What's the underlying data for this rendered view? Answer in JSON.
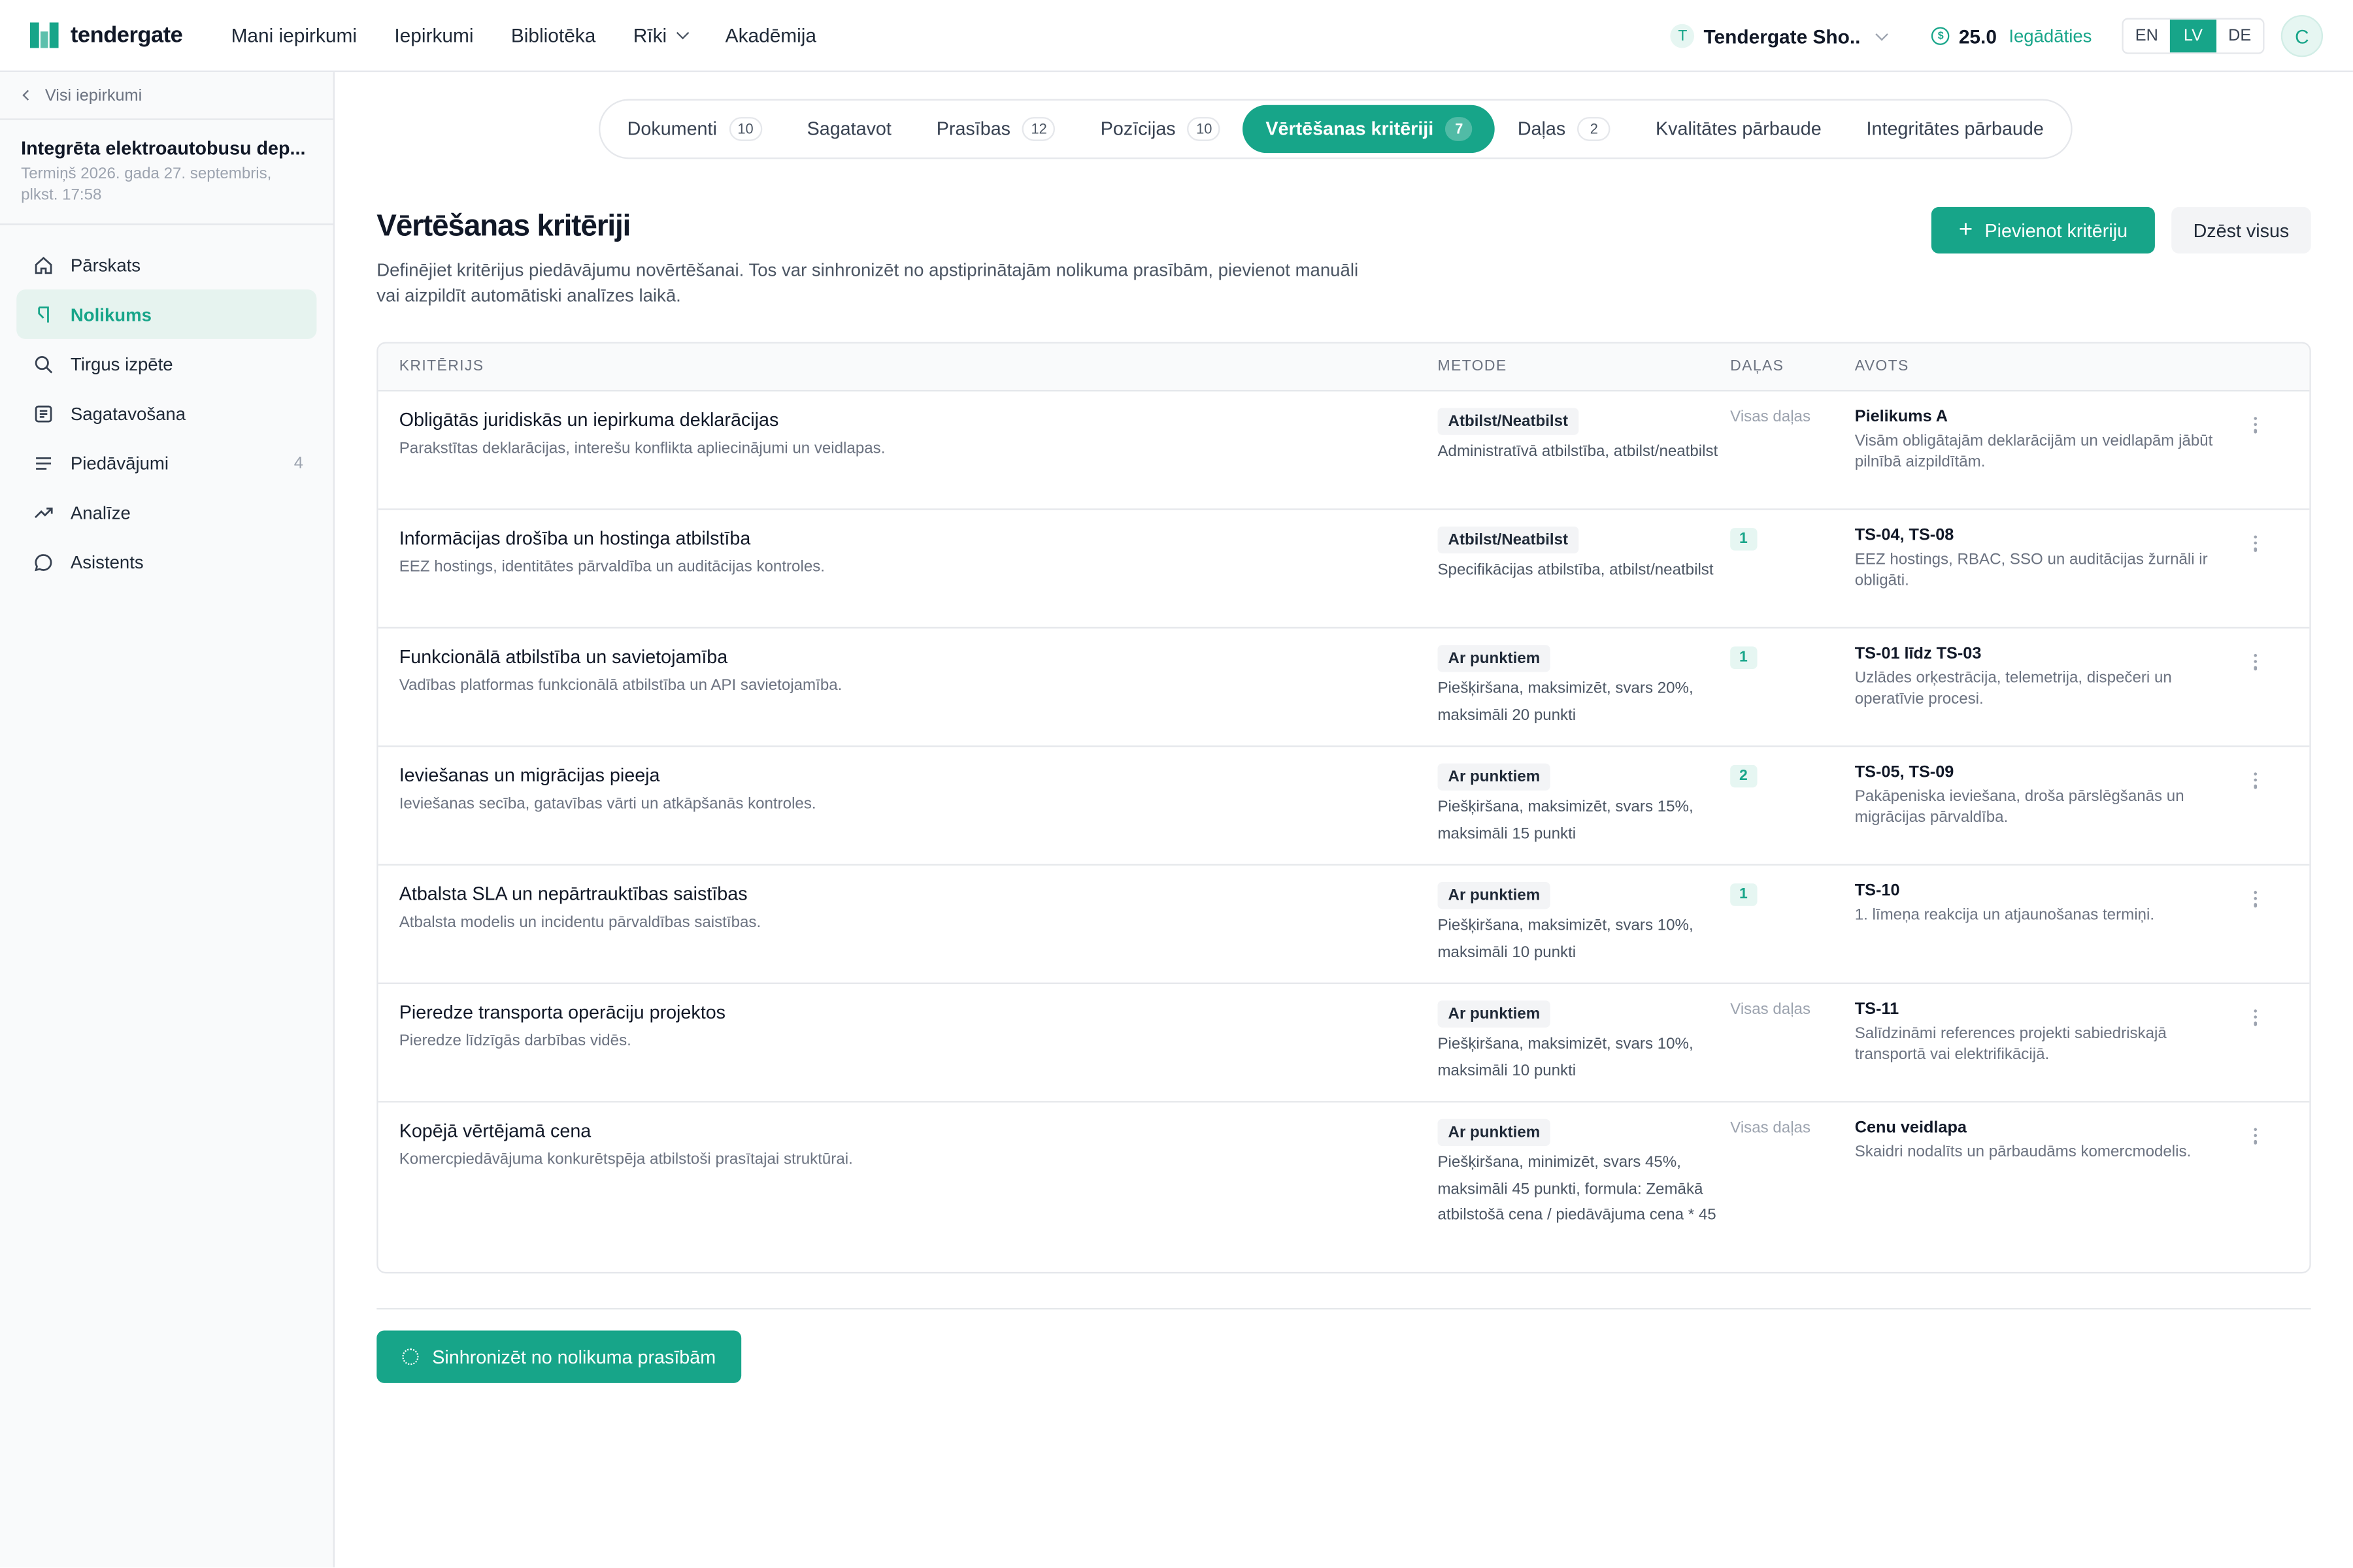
{
  "brand": {
    "name": "tendergate"
  },
  "topnav": [
    {
      "label": "Mani iepirkumi"
    },
    {
      "label": "Iepirkumi"
    },
    {
      "label": "Bibliotēka"
    },
    {
      "label": "Rīki"
    },
    {
      "label": "Akadēmija"
    }
  ],
  "workspace": {
    "initial": "T",
    "name": "Tendergate Sho..."
  },
  "credits": {
    "value": "25.0",
    "link": "Iegādāties"
  },
  "languages": [
    {
      "code": "EN"
    },
    {
      "code": "LV"
    },
    {
      "code": "DE"
    }
  ],
  "user": {
    "initial": "C"
  },
  "sidebar": {
    "back": "Visi iepirkumi",
    "project_title": "Integrēta elektroautobusu dep...",
    "project_deadline": "Termiņš 2026. gada 27. septembris, plkst. 17:58",
    "items": [
      {
        "label": "Pārskats",
        "icon": "home-icon"
      },
      {
        "label": "Nolikums",
        "icon": "document-icon"
      },
      {
        "label": "Tirgus izpēte",
        "icon": "search-icon"
      },
      {
        "label": "Sagatavošana",
        "icon": "edit-icon"
      },
      {
        "label": "Piedāvājumi",
        "icon": "list-icon",
        "count": "4"
      },
      {
        "label": "Analīze",
        "icon": "trend-icon"
      },
      {
        "label": "Asistents",
        "icon": "chat-icon"
      }
    ]
  },
  "tabs": [
    {
      "label": "Dokumenti",
      "count": "10"
    },
    {
      "label": "Sagatavot"
    },
    {
      "label": "Prasības",
      "count": "12"
    },
    {
      "label": "Pozīcijas",
      "count": "10"
    },
    {
      "label": "Vērtēšanas kritēriji",
      "count": "7"
    },
    {
      "label": "Daļas",
      "count": "2"
    },
    {
      "label": "Kvalitātes pārbaude"
    },
    {
      "label": "Integritātes pārbaude"
    }
  ],
  "page": {
    "title": "Vērtēšanas kritēriji",
    "description": "Definējiet kritērijus piedāvājumu novērtēšanai. Tos var sinhronizēt no apstiprinātajām nolikuma prasībām, pievienot manuāli vai aizpildīt automātiski analīzes laikā.",
    "add_button": "Pievienot kritēriju",
    "delete_button": "Dzēst visus",
    "sync_button": "Sinhronizēt no nolikuma prasībām"
  },
  "table": {
    "headers": {
      "criterion": "KRITĒRIJS",
      "method": "METODE",
      "parts": "DAĻAS",
      "source": "AVOTS"
    },
    "rows": [
      {
        "name": "Obligātās juridiskās un iepirkuma deklarācijas",
        "desc": "Parakstītas deklarācijas, interešu konflikta apliecinājumi un veidlapas.",
        "method": "Atbilst/Neatbilst",
        "method_desc": "Administratīvā atbilstība, atbilst/neatbilst",
        "parts": "Visas daļas",
        "source": "Pielikums A",
        "source_desc": "Visām obligātajām deklarācijām un veidlapām jābūt pilnībā aizpildītām."
      },
      {
        "name": "Informācijas drošība un hostinga atbilstība",
        "desc": "EEZ hostings, identitātes pārvaldība un auditācijas kontroles.",
        "method": "Atbilst/Neatbilst",
        "method_desc": "Specifikācijas atbilstība, atbilst/neatbilst",
        "parts": "1",
        "source": "TS-04, TS-08",
        "source_desc": "EEZ hostings, RBAC, SSO un auditācijas žurnāli ir obligāti."
      },
      {
        "name": "Funkcionālā atbilstība un savietojamība",
        "desc": "Vadības platformas funkcionālā atbilstība un API savietojamība.",
        "method": "Ar punktiem",
        "method_desc": "Piešķiršana, maksimizēt, svars 20%, maksimāli 20 punkti",
        "parts": "1",
        "source": "TS-01 līdz TS-03",
        "source_desc": "Uzlādes orķestrācija, telemetrija, dispečeri un operatīvie procesi."
      },
      {
        "name": "Ieviešanas un migrācijas pieeja",
        "desc": "Ieviešanas secība, gatavības vārti un atkāpšanās kontroles.",
        "method": "Ar punktiem",
        "method_desc": "Piešķiršana, maksimizēt, svars 15%, maksimāli 15 punkti",
        "parts": "2",
        "source": "TS-05, TS-09",
        "source_desc": "Pakāpeniska ieviešana, droša pārslēgšanās un migrācijas pārvaldība."
      },
      {
        "name": "Atbalsta SLA un nepārtrauktības saistības",
        "desc": "Atbalsta modelis un incidentu pārvaldības saistības.",
        "method": "Ar punktiem",
        "method_desc": "Piešķiršana, maksimizēt, svars 10%, maksimāli 10 punkti",
        "parts": "1",
        "source": "TS-10",
        "source_desc": "1. līmeņa reakcija un atjaunošanas termiņi."
      },
      {
        "name": "Pieredze transporta operāciju projektos",
        "desc": "Pieredze līdzīgās darbības vidēs.",
        "method": "Ar punktiem",
        "method_desc": "Piešķiršana, maksimizēt, svars 10%, maksimāli 10 punkti",
        "parts": "Visas daļas",
        "source": "TS-11",
        "source_desc": "Salīdzināmi references projekti sabiedriskajā transportā vai elektrifikācijā."
      },
      {
        "name": "Kopējā vērtējamā cena",
        "desc": "Komercpiedāvājuma konkurētspēja atbilstoši prasītajai struktūrai.",
        "method": "Ar punktiem",
        "method_desc": "Piešķiršana, minimizēt, svars 45%, maksimāli 45 punkti, formula: Zemākā atbilstošā cena / piedāvājuma cena * 45",
        "parts": "Visas daļas",
        "source": "Cenu veidlapa",
        "source_desc": "Skaidri nodalīts un pārbaudāms komercmodelis."
      }
    ]
  }
}
